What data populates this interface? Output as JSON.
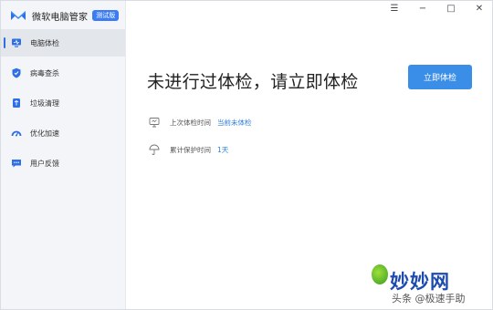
{
  "app": {
    "title": "微软电脑管家",
    "badge": "测试版"
  },
  "window_controls": {
    "menu": "☰",
    "minimize": "−",
    "maximize": "□",
    "close": "✕"
  },
  "sidebar": {
    "items": [
      {
        "label": "电脑体检",
        "icon": "monitor-icon",
        "active": true
      },
      {
        "label": "病毒查杀",
        "icon": "shield-icon",
        "active": false
      },
      {
        "label": "垃圾清理",
        "icon": "recycle-icon",
        "active": false
      },
      {
        "label": "优化加速",
        "icon": "speedometer-icon",
        "active": false
      },
      {
        "label": "用户反馈",
        "icon": "feedback-icon",
        "active": false
      }
    ]
  },
  "main": {
    "headline": "未进行过体检，请立即体检",
    "cta_label": "立即体检",
    "info": [
      {
        "label": "上次体检时间",
        "value": "当前未体检",
        "icon": "screen-icon"
      },
      {
        "label": "累计保护时间",
        "value": "1天",
        "icon": "umbrella-icon"
      }
    ]
  },
  "watermark": {
    "brand": "妙妙网",
    "caption": "头条 @极速手助"
  },
  "colors": {
    "accent": "#3a8ee8",
    "active_bar": "#2f6fe6",
    "link": "#2f7fdc"
  }
}
